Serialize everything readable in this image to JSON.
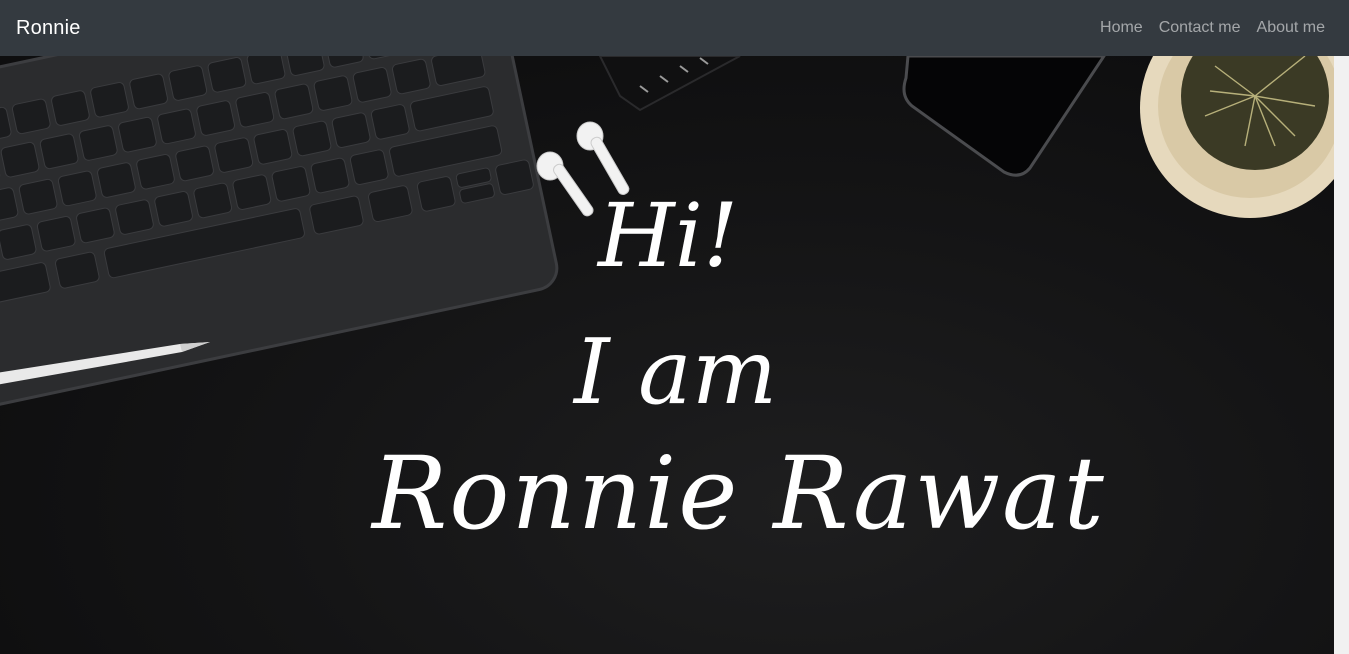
{
  "navbar": {
    "brand": "Ronnie",
    "links": [
      {
        "label": "Home"
      },
      {
        "label": "Contact me"
      },
      {
        "label": "About me"
      }
    ]
  },
  "hero": {
    "greeting": "Hi!",
    "intro": "I am",
    "name": "Ronnie Rawat",
    "background": "desk-flatlay-image"
  },
  "colors": {
    "navbar_bg": "#343a40",
    "hero_bg": "#151516",
    "text": "#ffffff",
    "link": "rgba(255,255,255,0.55)"
  }
}
